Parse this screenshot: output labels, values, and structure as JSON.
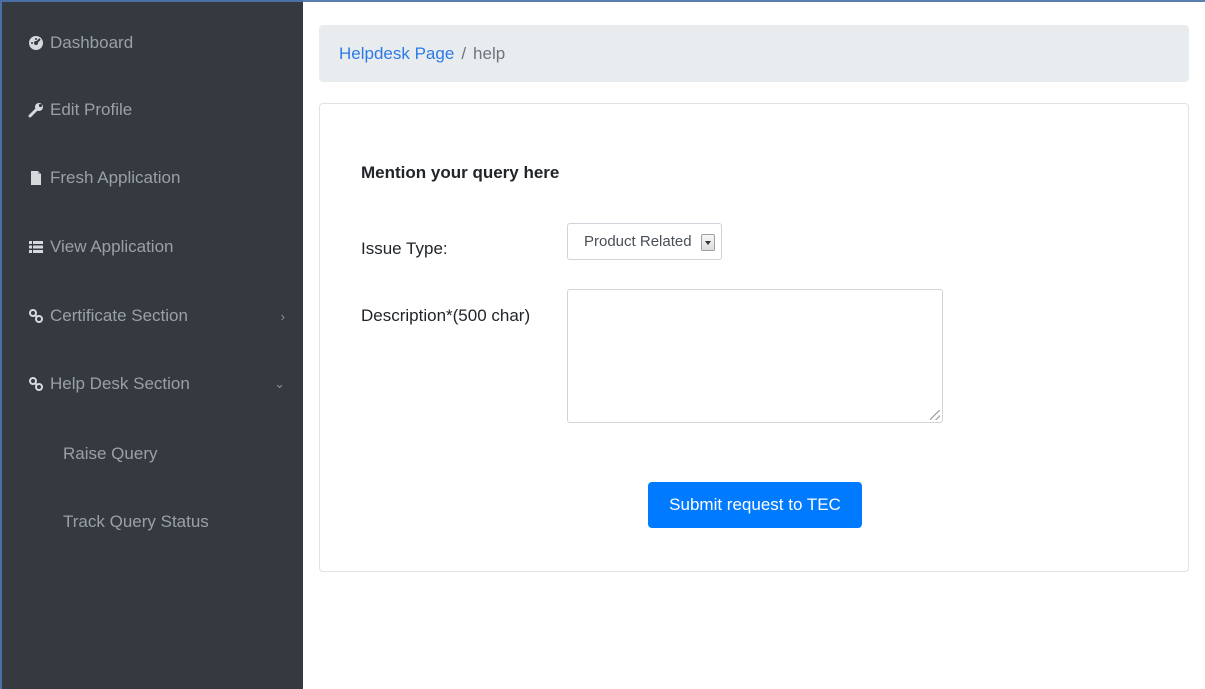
{
  "sidebar": {
    "items": [
      {
        "label": "Dashboard",
        "icon": "tachometer-icon"
      },
      {
        "label": "Edit Profile",
        "icon": "wrench-icon"
      },
      {
        "label": "Fresh Application",
        "icon": "file-icon"
      },
      {
        "label": "View Application",
        "icon": "list-icon"
      },
      {
        "label": "Certificate Section",
        "icon": "link-icon",
        "chevron": "›"
      },
      {
        "label": "Help Desk Section",
        "icon": "link-icon",
        "chevron": "⌄"
      }
    ],
    "subitems": [
      {
        "label": "Raise Query"
      },
      {
        "label": "Track Query Status"
      }
    ]
  },
  "breadcrumb": {
    "link": "Helpdesk Page",
    "separator": "/",
    "current": "help"
  },
  "form": {
    "heading": "Mention your query here",
    "issue_label": "Issue Type:",
    "issue_value": "Product Related",
    "description_label": "Description*(500 char)",
    "description_value": "",
    "submit_label": "Submit request to TEC"
  },
  "colors": {
    "sidebar_bg": "#343a40",
    "accent": "#007bff",
    "link": "#2c7be5",
    "breadcrumb_bg": "#e9ecef"
  }
}
